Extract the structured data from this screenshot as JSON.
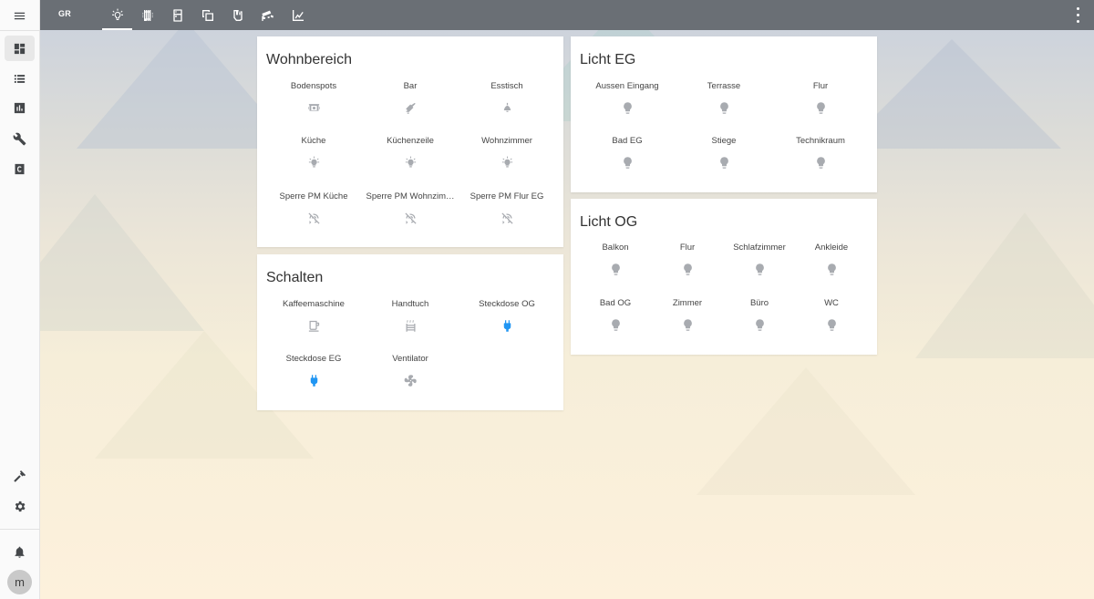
{
  "header": {
    "home_label": "GR",
    "tabs": [
      {
        "icon": "lightbulb-icon",
        "active": true
      },
      {
        "icon": "radiator-icon",
        "active": false
      },
      {
        "icon": "fridge-icon",
        "active": false
      },
      {
        "icon": "copy-icon",
        "active": false
      },
      {
        "icon": "hand-icon",
        "active": false
      },
      {
        "icon": "cctv-icon",
        "active": false
      },
      {
        "icon": "chart-icon",
        "active": false
      }
    ]
  },
  "sidebar": {
    "top_items": [
      "dashboard-icon",
      "list-icon",
      "history-icon",
      "wrench-icon",
      "hacs-icon"
    ],
    "bottom_items": [
      "hammer-icon",
      "settings-icon",
      "bell-icon"
    ],
    "avatar_initial": "m"
  },
  "cards": {
    "wohnbereich": {
      "title": "Wohnbereich",
      "entities": [
        {
          "label": "Bodenspots",
          "icon": "ceiling-spot-icon",
          "on": false
        },
        {
          "label": "Bar",
          "icon": "pendant-lamp-icon",
          "on": false
        },
        {
          "label": "Esstisch",
          "icon": "ceiling-lamp-icon",
          "on": false
        },
        {
          "label": "Küche",
          "icon": "bulb-on-icon",
          "on": false
        },
        {
          "label": "Küchenzeile",
          "icon": "bulb-on-icon",
          "on": false
        },
        {
          "label": "Wohnzimmer",
          "icon": "bulb-on-icon",
          "on": false
        },
        {
          "label": "Sperre PM Küche",
          "icon": "motion-off-icon",
          "on": false
        },
        {
          "label": "Sperre PM Wohnzim…",
          "icon": "motion-off-icon",
          "on": false
        },
        {
          "label": "Sperre PM Flur EG",
          "icon": "motion-off-icon",
          "on": false
        }
      ]
    },
    "schalten": {
      "title": "Schalten",
      "entities": [
        {
          "label": "Kaffeemaschine",
          "icon": "coffee-maker-icon",
          "on": false
        },
        {
          "label": "Handtuch",
          "icon": "towel-heater-icon",
          "on": false
        },
        {
          "label": "Steckdose OG",
          "icon": "power-plug-icon",
          "on": true
        },
        {
          "label": "Steckdose EG",
          "icon": "power-plug-icon",
          "on": true
        },
        {
          "label": "Ventilator",
          "icon": "fan-icon",
          "on": false
        }
      ]
    },
    "licht_eg": {
      "title": "Licht EG",
      "entities": [
        {
          "label": "Aussen Eingang",
          "icon": "bulb-icon",
          "on": false
        },
        {
          "label": "Terrasse",
          "icon": "bulb-icon",
          "on": false
        },
        {
          "label": "Flur",
          "icon": "bulb-icon",
          "on": false
        },
        {
          "label": "Bad EG",
          "icon": "bulb-icon",
          "on": false
        },
        {
          "label": "Stiege",
          "icon": "bulb-icon",
          "on": false
        },
        {
          "label": "Technikraum",
          "icon": "bulb-icon",
          "on": false
        }
      ]
    },
    "licht_og": {
      "title": "Licht OG",
      "entities": [
        {
          "label": "Balkon",
          "icon": "bulb-icon",
          "on": false
        },
        {
          "label": "Flur",
          "icon": "bulb-icon",
          "on": false
        },
        {
          "label": "Schlafzimmer",
          "icon": "bulb-icon",
          "on": false
        },
        {
          "label": "Ankleide",
          "icon": "bulb-icon",
          "on": false
        },
        {
          "label": "Bad OG",
          "icon": "bulb-icon",
          "on": false
        },
        {
          "label": "Zimmer",
          "icon": "bulb-icon",
          "on": false
        },
        {
          "label": "Büro",
          "icon": "bulb-icon",
          "on": false
        },
        {
          "label": "WC",
          "icon": "bulb-icon",
          "on": false
        }
      ]
    }
  },
  "colors": {
    "header_bg": "#6a6f75",
    "icon_off": "#a8abb0",
    "icon_on": "#2196f3"
  }
}
